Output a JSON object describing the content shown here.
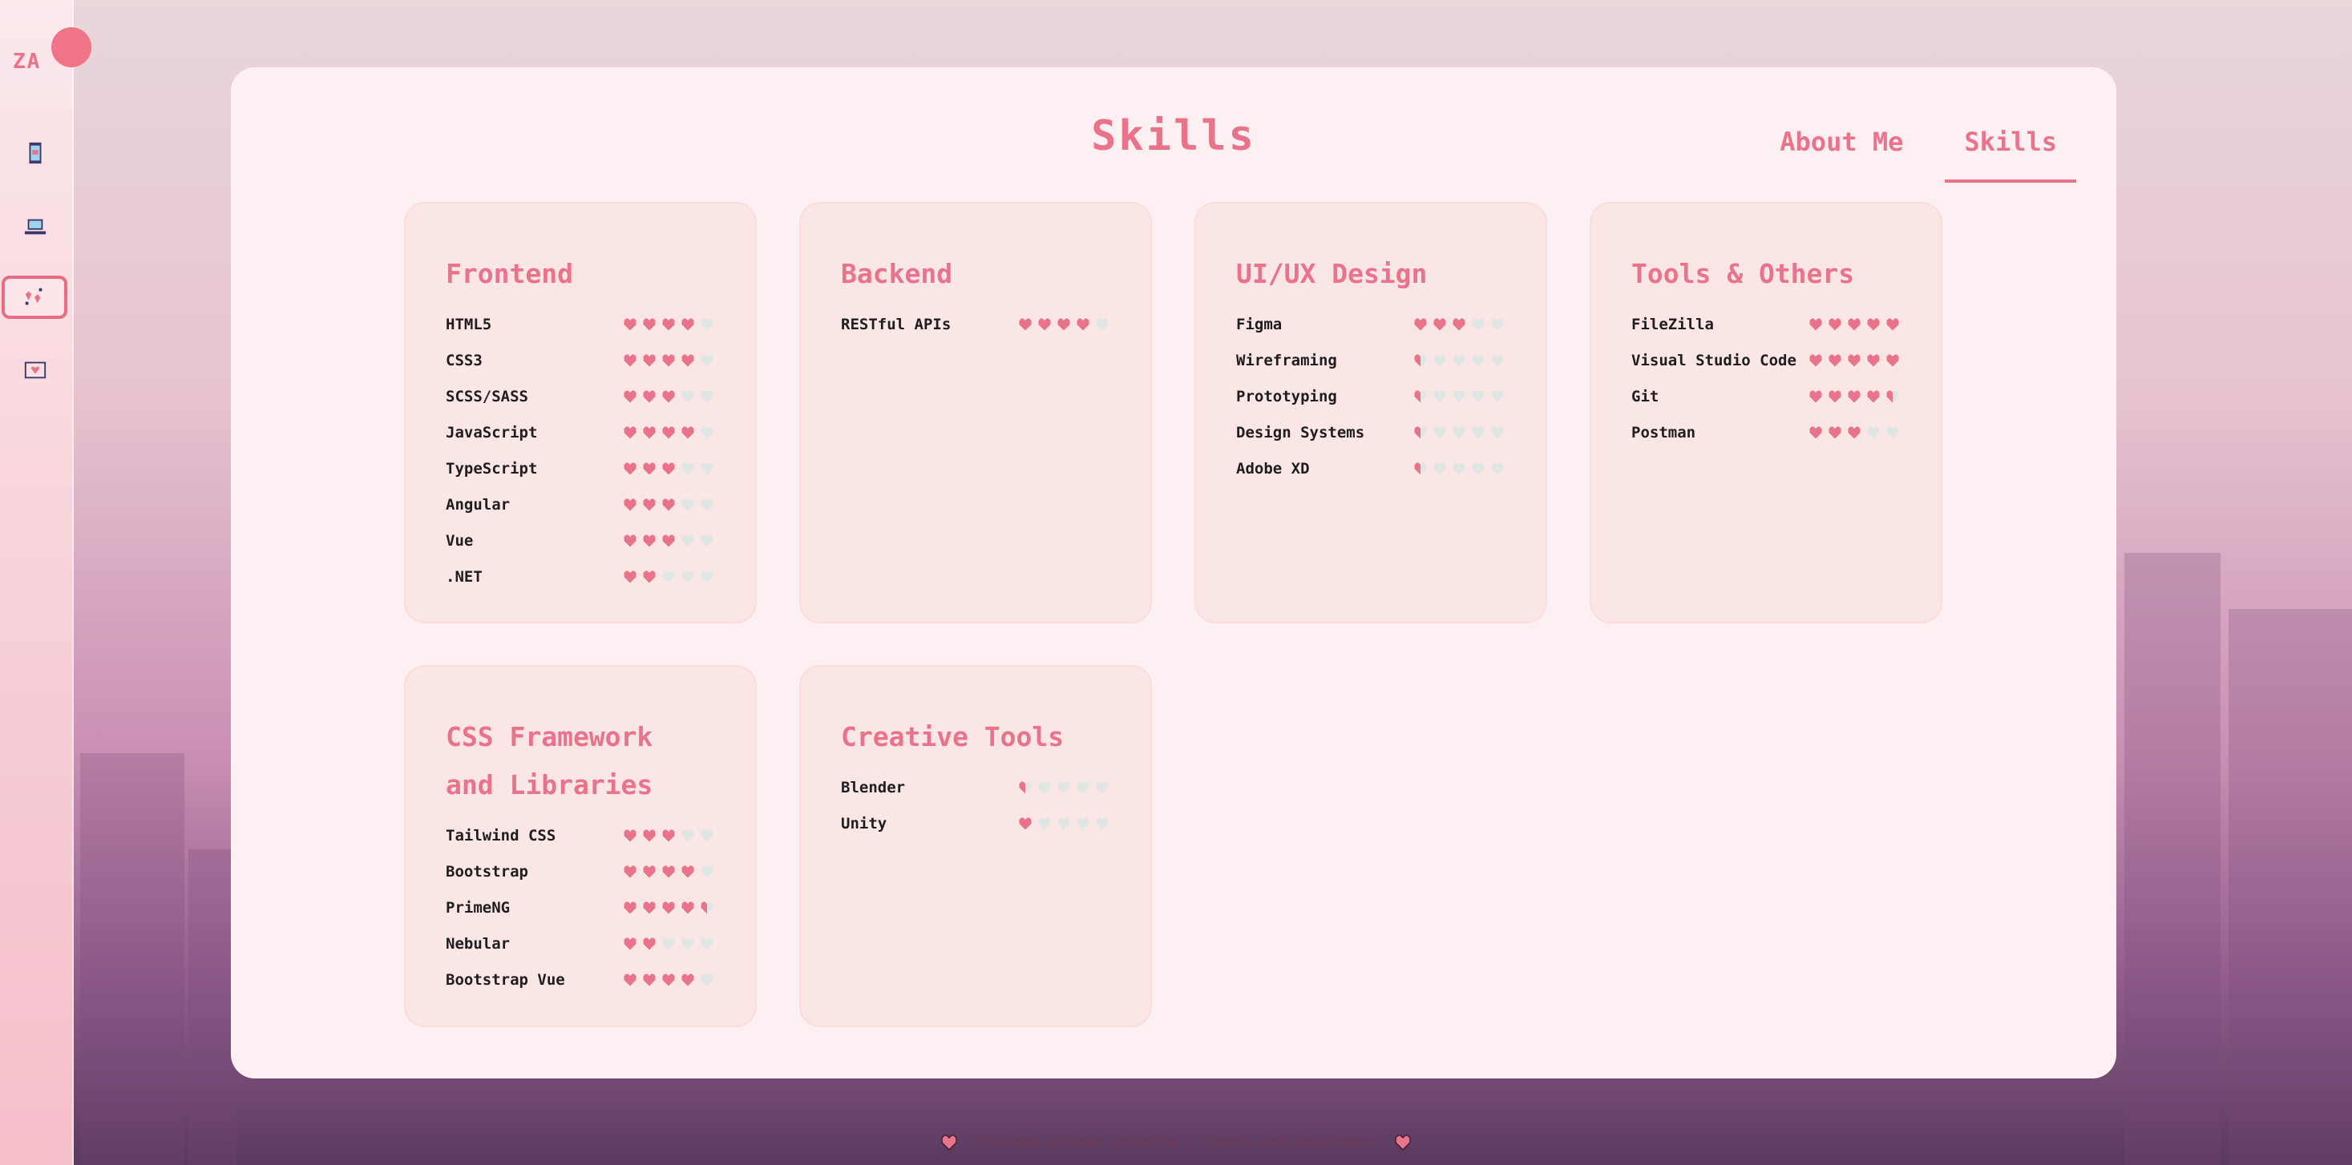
{
  "sidebar": {
    "logo_text": "ZA",
    "items": [
      {
        "name": "phone-icon",
        "active": false
      },
      {
        "name": "laptop-icon",
        "active": false
      },
      {
        "name": "sparkle-hearts-icon",
        "active": true
      },
      {
        "name": "heart-mail-icon",
        "active": false
      }
    ]
  },
  "header": {
    "title": "Skills",
    "tabs": [
      {
        "label": "About Me",
        "active": false
      },
      {
        "label": "Skills",
        "active": true
      }
    ]
  },
  "colors": {
    "accent": "#e8738a",
    "heart_full": "#e8738a",
    "heart_empty": "#dfe6e3",
    "card_bg": "#fbe6e6",
    "panel_bg": "#fdf0f3"
  },
  "rating_scale_max": 5,
  "cards": [
    {
      "title": "Frontend",
      "skills": [
        {
          "name": "HTML5",
          "rating": 4
        },
        {
          "name": "CSS3",
          "rating": 4
        },
        {
          "name": "SCSS/SASS",
          "rating": 3
        },
        {
          "name": "JavaScript",
          "rating": 4
        },
        {
          "name": "TypeScript",
          "rating": 3
        },
        {
          "name": "Angular",
          "rating": 3
        },
        {
          "name": "Vue",
          "rating": 3
        },
        {
          "name": ".NET",
          "rating": 2
        }
      ]
    },
    {
      "title": "Backend",
      "skills": [
        {
          "name": "RESTful APIs",
          "rating": 4
        }
      ]
    },
    {
      "title": "UI/UX Design",
      "skills": [
        {
          "name": "Figma",
          "rating": 3
        },
        {
          "name": "Wireframing",
          "rating": 0.5
        },
        {
          "name": "Prototyping",
          "rating": 0.5
        },
        {
          "name": "Design Systems",
          "rating": 0.5
        },
        {
          "name": "Adobe XD",
          "rating": 0.5
        }
      ]
    },
    {
      "title": "Tools & Others",
      "skills": [
        {
          "name": "FileZilla",
          "rating": 5
        },
        {
          "name": "Visual Studio Code",
          "rating": 5
        },
        {
          "name": "Git",
          "rating": 4.5
        },
        {
          "name": "Postman",
          "rating": 3
        }
      ]
    },
    {
      "title": "CSS Framework and Libraries",
      "skills": [
        {
          "name": "Tailwind CSS",
          "rating": 3
        },
        {
          "name": "Bootstrap",
          "rating": 4
        },
        {
          "name": "PrimeNG",
          "rating": 4.5
        },
        {
          "name": "Nebular",
          "rating": 2
        },
        {
          "name": "Bootstrap Vue",
          "rating": 4
        }
      ]
    },
    {
      "title": "Creative Tools",
      "skills": [
        {
          "name": "Blender",
          "rating": 0.5
        },
        {
          "name": "Unity",
          "rating": 1
        }
      ]
    }
  ],
  "footer": {
    "text": "Zaireen Akhzar Zakaria | Front-end Developer"
  }
}
